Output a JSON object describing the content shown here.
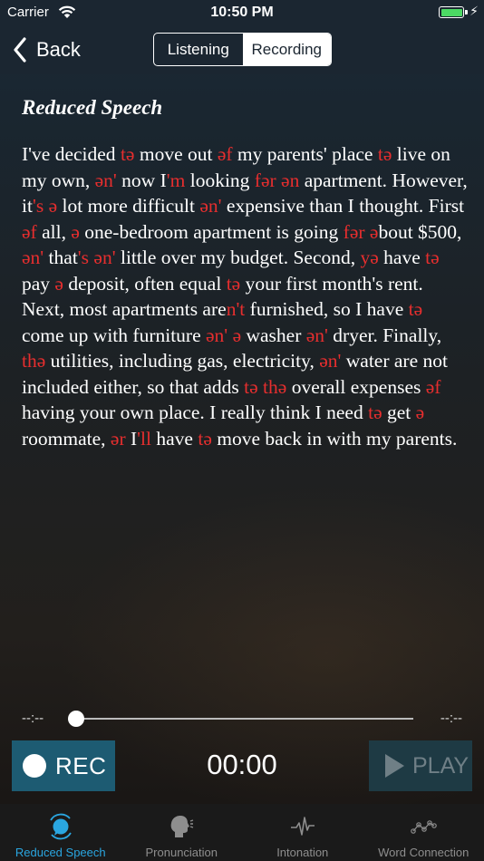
{
  "status_bar": {
    "carrier": "Carrier",
    "time": "10:50 PM"
  },
  "nav": {
    "back_label": "Back",
    "segments": [
      {
        "label": "Listening",
        "selected": false
      },
      {
        "label": "Recording",
        "selected": true
      }
    ]
  },
  "content": {
    "title": "Reduced Speech",
    "passage": [
      {
        "t": "I've decided "
      },
      {
        "t": "tə",
        "r": true
      },
      {
        "t": " move out "
      },
      {
        "t": "əf",
        "r": true
      },
      {
        "t": " my parents' place "
      },
      {
        "t": "tə",
        "r": true
      },
      {
        "t": " live on my own, "
      },
      {
        "t": "ən'",
        "r": true
      },
      {
        "t": " now I"
      },
      {
        "t": "'m",
        "r": true
      },
      {
        "t": " looking "
      },
      {
        "t": "fər ən",
        "r": true
      },
      {
        "t": " apartment. However, it"
      },
      {
        "t": "'s ə",
        "r": true
      },
      {
        "t": " lot more difficult "
      },
      {
        "t": "ən'",
        "r": true
      },
      {
        "t": " expensive than I thought. First "
      },
      {
        "t": "əf",
        "r": true
      },
      {
        "t": " all, "
      },
      {
        "t": "ə",
        "r": true
      },
      {
        "t": " one-bedroom apartment is going "
      },
      {
        "t": "fər",
        "r": true
      },
      {
        "t": " "
      },
      {
        "t": "ə",
        "r": true
      },
      {
        "t": "bout $500, "
      },
      {
        "t": "ən'",
        "r": true
      },
      {
        "t": " that"
      },
      {
        "t": "'s ən'",
        "r": true
      },
      {
        "t": " little over my budget. Second, "
      },
      {
        "t": "yə",
        "r": true
      },
      {
        "t": " have "
      },
      {
        "t": "tə",
        "r": true
      },
      {
        "t": " pay "
      },
      {
        "t": "ə",
        "r": true
      },
      {
        "t": " deposit, often equal "
      },
      {
        "t": "tə",
        "r": true
      },
      {
        "t": " your first month's rent. Next, most apartments are"
      },
      {
        "t": "n't",
        "r": true
      },
      {
        "t": " furnished, so I have "
      },
      {
        "t": "tə",
        "r": true
      },
      {
        "t": " come up with furniture "
      },
      {
        "t": "ən'",
        "r": true
      },
      {
        "t": " "
      },
      {
        "t": "ə",
        "r": true
      },
      {
        "t": " washer "
      },
      {
        "t": "ən'",
        "r": true
      },
      {
        "t": " dryer. Finally, "
      },
      {
        "t": "thə",
        "r": true
      },
      {
        "t": " utilities, including gas, electricity, "
      },
      {
        "t": "ən'",
        "r": true
      },
      {
        "t": " water are not included either, so that adds "
      },
      {
        "t": "tə thə",
        "r": true
      },
      {
        "t": " overall expenses "
      },
      {
        "t": "əf",
        "r": true
      },
      {
        "t": " having your own place. I really think I need "
      },
      {
        "t": "tə",
        "r": true
      },
      {
        "t": " get "
      },
      {
        "t": "ə",
        "r": true
      },
      {
        "t": " roommate, "
      },
      {
        "t": "ər",
        "r": true
      },
      {
        "t": " I"
      },
      {
        "t": "'ll",
        "r": true
      },
      {
        "t": " have "
      },
      {
        "t": "tə",
        "r": true
      },
      {
        "t": " move back in with my parents."
      }
    ]
  },
  "player": {
    "elapsed": "--:--",
    "remaining": "--:--",
    "progress": 0,
    "rec_label": "REC",
    "timer": "00:00",
    "play_label": "PLAY"
  },
  "tabs": [
    {
      "label": "Reduced Speech",
      "icon": "reduced-speech-icon",
      "active": true
    },
    {
      "label": "Pronunciation",
      "icon": "speaking-head-icon",
      "active": false
    },
    {
      "label": "Intonation",
      "icon": "waveform-icon",
      "active": false
    },
    {
      "label": "Word Connection",
      "icon": "connected-dots-icon",
      "active": false
    }
  ],
  "colors": {
    "accent": "#2aa6e0",
    "reduced": "#e62e2e",
    "rec_bg": "#1d5b72",
    "nav_bg": "#1b2631"
  }
}
